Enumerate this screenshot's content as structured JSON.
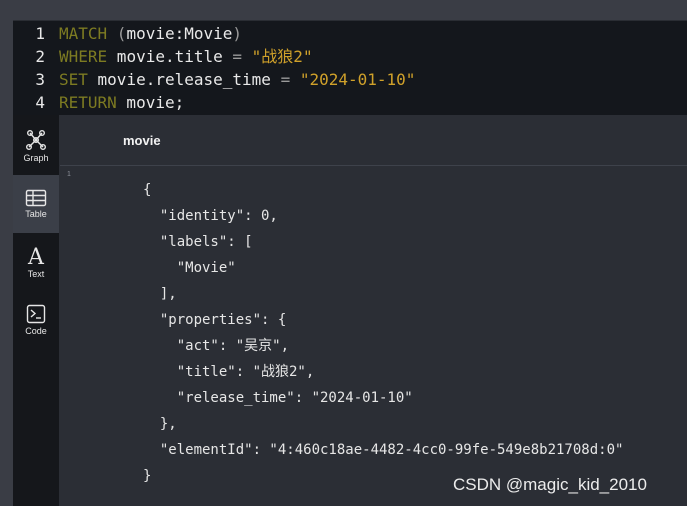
{
  "editor": {
    "lines": [
      {
        "num": "1",
        "kw": "MATCH",
        "rest1": " (",
        "ident": "movie:Movie",
        "rest2": ")"
      },
      {
        "num": "2",
        "kw": "WHERE",
        "ident": " movie.title",
        "op": " = ",
        "str": "\"战狼2\""
      },
      {
        "num": "3",
        "kw": "SET",
        "ident": " movie.release_time",
        "op": " = ",
        "str": "\"2024-01-10\""
      },
      {
        "num": "4",
        "kw": "RETURN",
        "ident": " movie;"
      }
    ]
  },
  "sidebar": {
    "items": [
      {
        "label": "Graph",
        "icon": "graph-icon"
      },
      {
        "label": "Table",
        "icon": "table-icon"
      },
      {
        "label": "Text",
        "icon": "text-icon"
      },
      {
        "label": "Code",
        "icon": "code-icon"
      }
    ],
    "active": "Table"
  },
  "result": {
    "column_header": "movie",
    "row_number": "1",
    "json_lines": [
      "{",
      "  \"identity\": 0,",
      "  \"labels\": [",
      "    \"Movie\"",
      "  ],",
      "  \"properties\": {",
      "    \"act\": \"吴京\",",
      "    \"title\": \"战狼2\",",
      "    \"release_time\": \"2024-01-10\"",
      "  },",
      "  \"elementId\": \"4:460c18ae-4482-4cc0-99fe-549e8b21708d:0\"",
      "}"
    ]
  },
  "watermark": "CSDN @magic_kid_2010"
}
